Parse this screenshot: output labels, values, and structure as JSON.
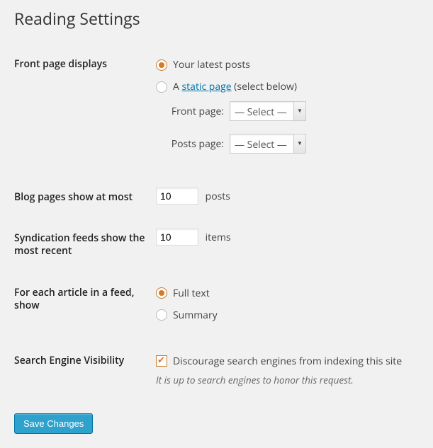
{
  "page": {
    "title": "Reading Settings"
  },
  "front_page": {
    "heading": "Front page displays",
    "option_latest": "Your latest posts",
    "option_static_prefix": "A ",
    "option_static_link": "static page",
    "option_static_suffix": " (select below)",
    "front_page_label": "Front page:",
    "posts_page_label": "Posts page:",
    "select_placeholder": "— Select —"
  },
  "blog_pages": {
    "heading": "Blog pages show at most",
    "value": "10",
    "suffix": "posts"
  },
  "syndication": {
    "heading": "Syndication feeds show the most recent",
    "value": "10",
    "suffix": "items"
  },
  "feed_article": {
    "heading": "For each article in a feed, show",
    "option_full": "Full text",
    "option_summary": "Summary"
  },
  "search_engine": {
    "heading": "Search Engine Visibility",
    "checkbox_label": "Discourage search engines from indexing this site",
    "description": "It is up to search engines to honor this request."
  },
  "submit": {
    "label": "Save Changes"
  }
}
